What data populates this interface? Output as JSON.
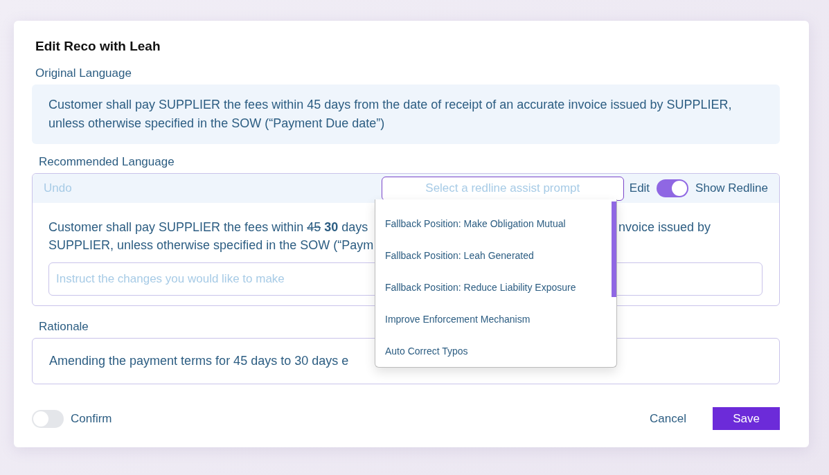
{
  "dialog": {
    "title": "Edit Reco with Leah"
  },
  "original": {
    "label": "Original Language",
    "text": "Customer shall pay SUPPLIER the fees within 45 days from the date of receipt of an accurate invoice issued by SUPPLIER, unless otherwise specified in the SOW (“Payment Due date”)"
  },
  "recommended": {
    "label": "Recommended Language",
    "undo": "Undo",
    "prompt_select": {
      "placeholder": "Select a redline assist prompt",
      "expanded": true
    },
    "edit": "Edit",
    "show_redline": {
      "label": "Show Redline",
      "on": true
    },
    "line_1": {
      "prefix": "Customer shall pay SUPPLIER the fees within ",
      "deleted": "45",
      "inserted": "30",
      "suffix": " days"
    },
    "line_1_right": "nvoice issued by",
    "line_2": "SUPPLIER, unless otherwise specified in the SOW (“Paym",
    "instruction": {
      "placeholder": "Instruct the changes you would like to make"
    }
  },
  "prompt_options": [
    {
      "label": "Fallback Position: Make Obligation Mutual"
    },
    {
      "label": "Fallback Position: Leah Generated"
    },
    {
      "label": "Fallback Position: Reduce Liability Exposure"
    },
    {
      "label": "Improve Enforcement Mechanism"
    },
    {
      "label": "Auto Correct Typos"
    }
  ],
  "rationale": {
    "label": "Rationale",
    "text": "Amending the payment terms for 45 days to 30 days e"
  },
  "footer": {
    "confirm": {
      "label": "Confirm",
      "on": false
    },
    "cancel": "Cancel",
    "save": "Save"
  }
}
